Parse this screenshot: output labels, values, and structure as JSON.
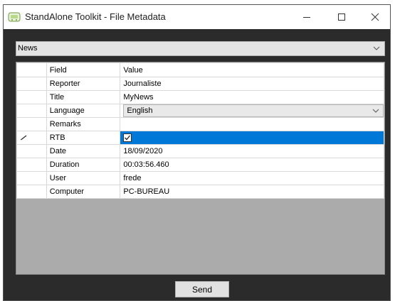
{
  "window": {
    "title": "StandAlone Toolkit - File Metadata"
  },
  "combo": {
    "selected": "News"
  },
  "grid": {
    "headers": [
      "Field",
      "Value"
    ],
    "rows": [
      {
        "field": "Reporter",
        "value": "Journaliste"
      },
      {
        "field": "Title",
        "value": "MyNews"
      },
      {
        "field": "Language",
        "value": "English"
      },
      {
        "field": "Remarks",
        "value": ""
      },
      {
        "field": "RTB",
        "value": "",
        "checked": true
      },
      {
        "field": "Date",
        "value": "18/09/2020"
      },
      {
        "field": "Duration",
        "value": "00:03:56.460"
      },
      {
        "field": "User",
        "value": "frede"
      },
      {
        "field": "Computer",
        "value": "PC-BUREAU"
      }
    ]
  },
  "footer": {
    "send_label": "Send"
  },
  "colors": {
    "selection": "#0078d7",
    "window_bg": "#2b2b2b",
    "grid_bg": "#ababab"
  }
}
